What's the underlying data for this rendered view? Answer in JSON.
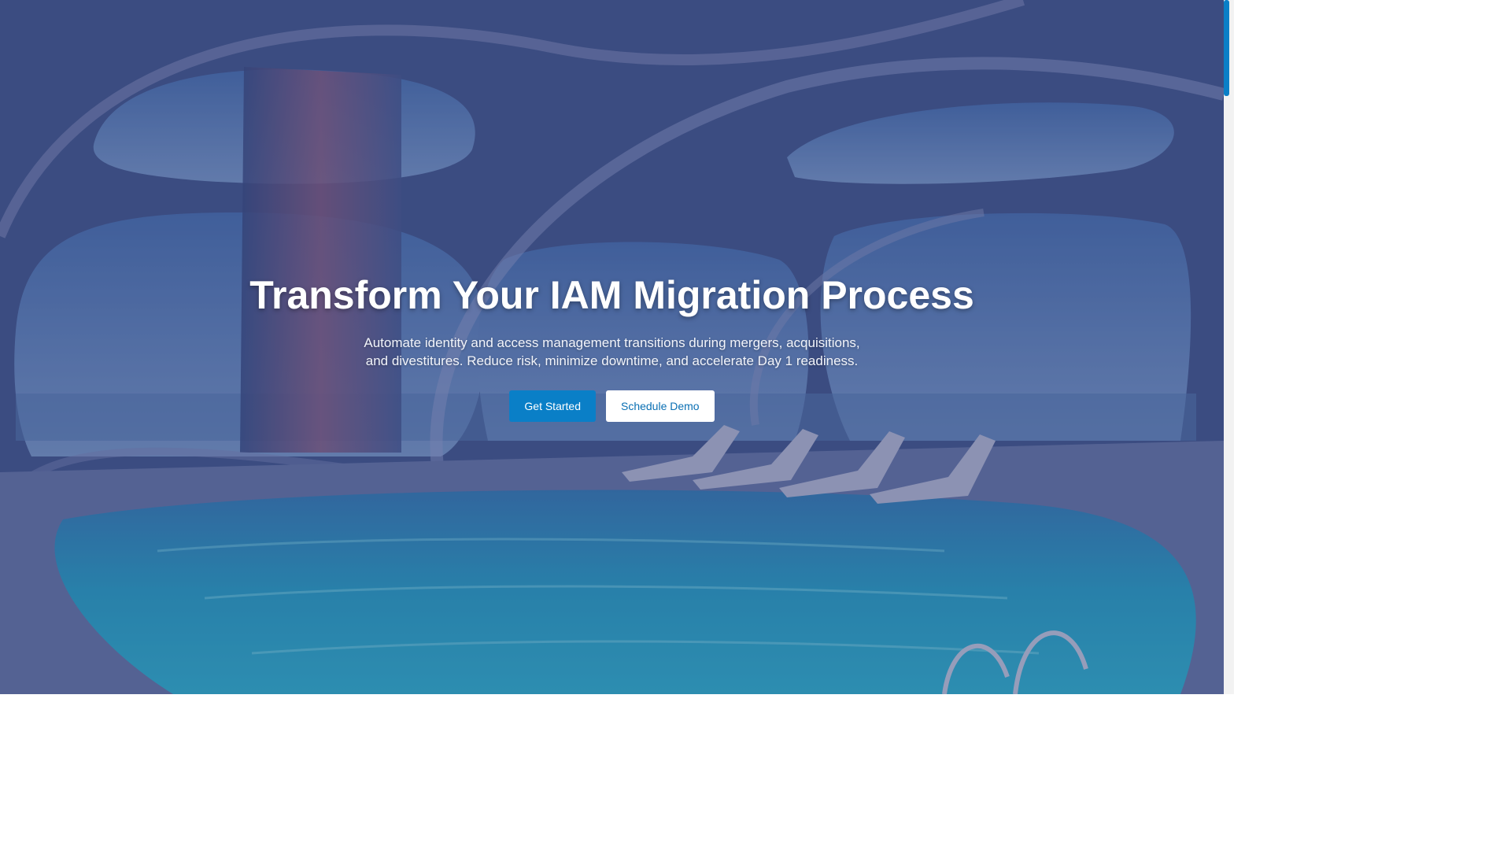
{
  "hero": {
    "title": "Transform Your IAM Migration Process",
    "subtitle": "Automate identity and access management transitions during mergers, acquisitions, and divestitures. Reduce risk, minimize downtime, and accelerate Day 1 readiness.",
    "primary_button": "Get Started",
    "secondary_button": "Schedule Demo",
    "background_image": "futuristic-indoor-pool-image"
  },
  "colors": {
    "accent": "#0a7fc7",
    "secondary_button_bg": "#ffffff",
    "text": "#ffffff"
  },
  "scrollbar": {
    "position_fraction": 0
  }
}
